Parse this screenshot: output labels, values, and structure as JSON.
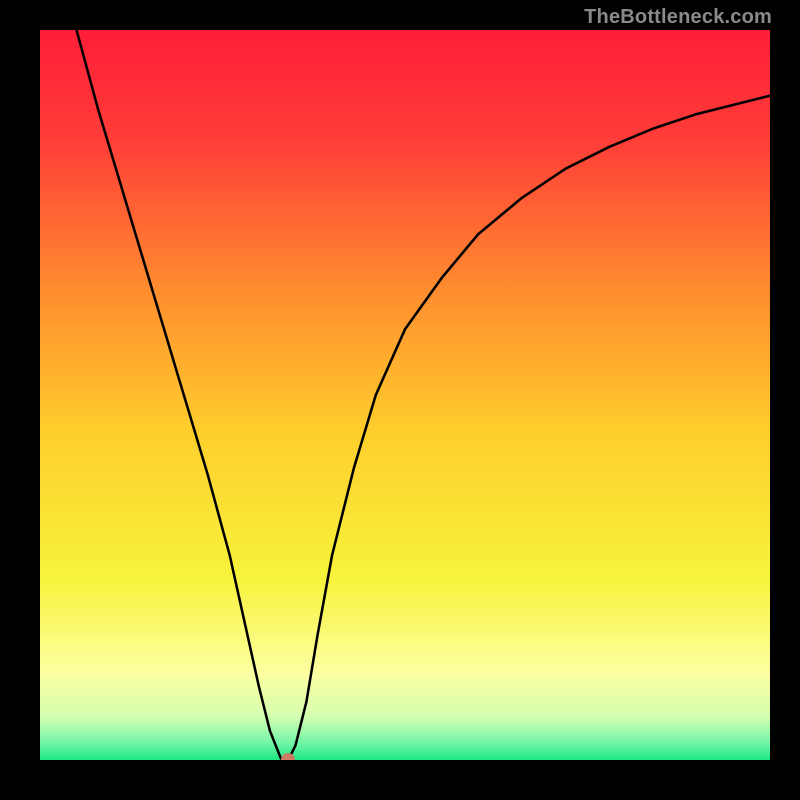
{
  "watermark": "TheBottleneck.com",
  "chart_data": {
    "type": "line",
    "title": "",
    "xlabel": "",
    "ylabel": "",
    "xlim": [
      0,
      100
    ],
    "ylim": [
      0,
      100
    ],
    "grid": false,
    "legend": false,
    "background_gradient": {
      "stops": [
        {
          "pos": 0.0,
          "color": "#ff1e38"
        },
        {
          "pos": 0.15,
          "color": "#ff3d38"
        },
        {
          "pos": 0.35,
          "color": "#ff8a2f"
        },
        {
          "pos": 0.55,
          "color": "#ffce2c"
        },
        {
          "pos": 0.75,
          "color": "#f7f33b"
        },
        {
          "pos": 0.88,
          "color": "#fdffa0"
        },
        {
          "pos": 0.94,
          "color": "#d5ffb0"
        },
        {
          "pos": 0.975,
          "color": "#78f5a8"
        },
        {
          "pos": 1.0,
          "color": "#1de884"
        }
      ]
    },
    "series": [
      {
        "name": "bottleneck-curve",
        "x": [
          5,
          8,
          11,
          14,
          17,
          20,
          23,
          26,
          28,
          30,
          31.5,
          33,
          34,
          35,
          36.5,
          38,
          40,
          43,
          46,
          50,
          55,
          60,
          66,
          72,
          78,
          84,
          90,
          96,
          100
        ],
        "y": [
          100,
          89,
          79,
          69,
          59,
          49,
          39,
          28,
          19,
          10,
          4,
          0.2,
          0,
          2,
          8,
          17,
          28,
          40,
          50,
          59,
          66,
          72,
          77,
          81,
          84,
          86.5,
          88.5,
          90,
          91
        ]
      }
    ],
    "marker": {
      "x": 34,
      "y": 0,
      "color": "#cf7a67"
    }
  }
}
